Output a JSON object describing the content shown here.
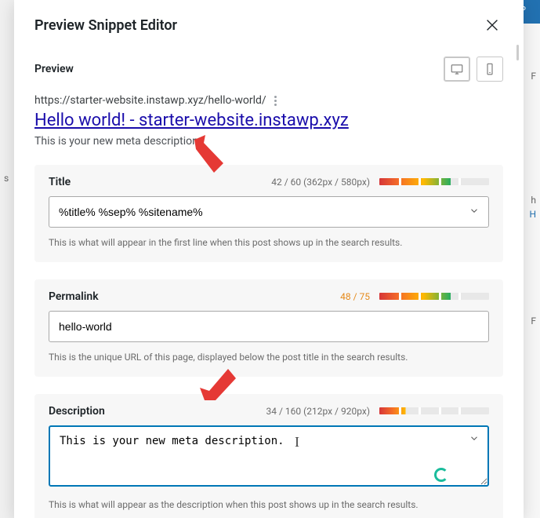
{
  "modal": {
    "title": "Preview Snippet Editor"
  },
  "preview": {
    "label": "Preview",
    "url": "https://starter-website.instawp.xyz/hello-world/",
    "serp_title": "Hello world! - starter-website.instawp.xyz",
    "serp_desc": "This is your new meta description"
  },
  "title": {
    "label": "Title",
    "counter": "42 / 60 (362px / 580px)",
    "value": "%title% %sep% %sitename%",
    "help": "This is what will appear in the first line when this post shows up in the search results."
  },
  "permalink": {
    "label": "Permalink",
    "counter": "48 / 75",
    "value": "hello-world",
    "help": "This is the unique URL of this page, displayed below the post title in the search results."
  },
  "description": {
    "label": "Description",
    "counter": "34 / 160 (212px / 920px)",
    "value": "This is your new meta description.",
    "help": "This is what will appear as the description when this post shows up in the search results."
  },
  "bg": {
    "p": "P",
    "f1": "F",
    "s": "s",
    "h": "h",
    "hl": "H",
    "f2": "F"
  }
}
